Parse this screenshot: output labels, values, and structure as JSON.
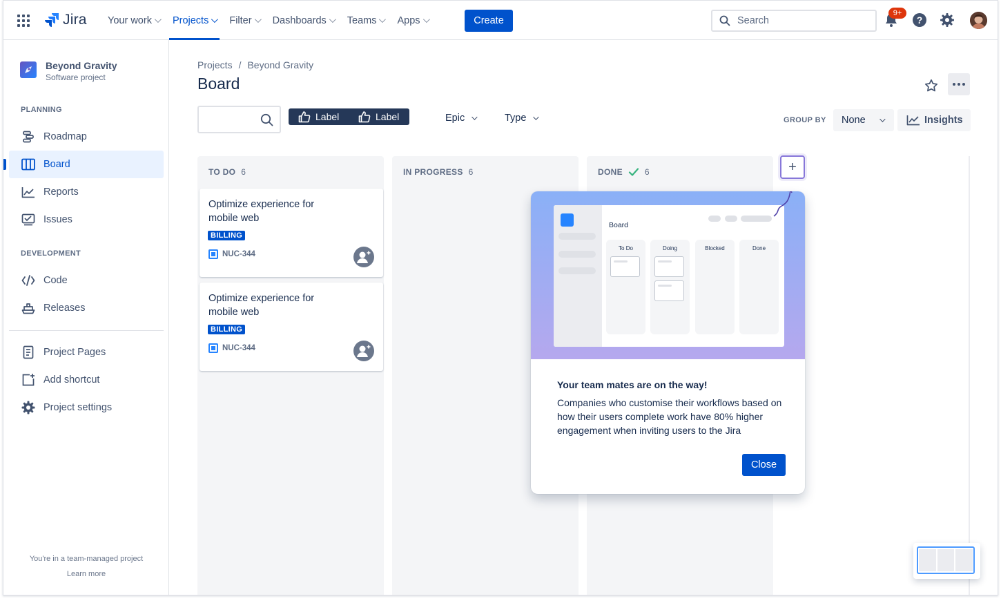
{
  "topnav": {
    "logo_text": "Jira",
    "items": [
      {
        "label": "Your work"
      },
      {
        "label": "Projects"
      },
      {
        "label": "Filter"
      },
      {
        "label": "Dashboards"
      },
      {
        "label": "Teams"
      },
      {
        "label": "Apps"
      }
    ],
    "active_item": "Projects",
    "create_label": "Create",
    "search_placeholder": "Search",
    "notification_badge": "9+"
  },
  "sidebar": {
    "project_name": "Beyond Gravity",
    "project_type": "Software project",
    "planning_title": "PLANNING",
    "planning_items": [
      {
        "label": "Roadmap",
        "icon": "roadmap-icon"
      },
      {
        "label": "Board",
        "icon": "board-icon"
      },
      {
        "label": "Reports",
        "icon": "reports-icon"
      },
      {
        "label": "Issues",
        "icon": "issues-icon"
      }
    ],
    "active_item": "Board",
    "development_title": "DEVELOPMENT",
    "development_items": [
      {
        "label": "Code",
        "icon": "code-icon"
      },
      {
        "label": "Releases",
        "icon": "releases-icon"
      }
    ],
    "extra_items": [
      {
        "label": "Project Pages",
        "icon": "page-icon"
      },
      {
        "label": "Add shortcut",
        "icon": "add-shortcut-icon"
      },
      {
        "label": "Project settings",
        "icon": "gear-icon"
      }
    ],
    "footer_text": "You're in a team-managed project",
    "footer_link": "Learn more"
  },
  "main": {
    "breadcrumb": [
      "Projects",
      "Beyond Gravity"
    ],
    "title": "Board",
    "filters": {
      "label_buttons": [
        "Label",
        "Label"
      ],
      "epic": "Epic",
      "type": "Type",
      "group_by_label": "GROUP BY",
      "group_by_value": "None",
      "insights": "Insights"
    },
    "columns": [
      {
        "name": "TO DO",
        "count": "6",
        "cards": [
          {
            "title": "Optimize experience for mobile web",
            "label": "BILLING",
            "key": "NUC-344"
          },
          {
            "title": "Optimize experience for mobile web",
            "label": "BILLING",
            "key": "NUC-344"
          }
        ]
      },
      {
        "name": "IN PROGRESS",
        "count": "6",
        "cards": []
      },
      {
        "name": "DONE",
        "count": "6",
        "cards": []
      }
    ]
  },
  "spotlight": {
    "mock_title": "Board",
    "mock_columns": [
      "To Do",
      "Doing",
      "Blocked",
      "Done"
    ],
    "title": "Your team mates are on the way!",
    "body": "Companies who customise their workflows based on how their users complete work have 80% higher engagement when inviting users to the Jira",
    "close_label": "Close"
  },
  "colors": {
    "brand": "#0052CC",
    "lozenge": "#0052CC",
    "badge": "#DE350B",
    "done_check": "#36B37E",
    "spotlight_accent": "#8777D9"
  }
}
